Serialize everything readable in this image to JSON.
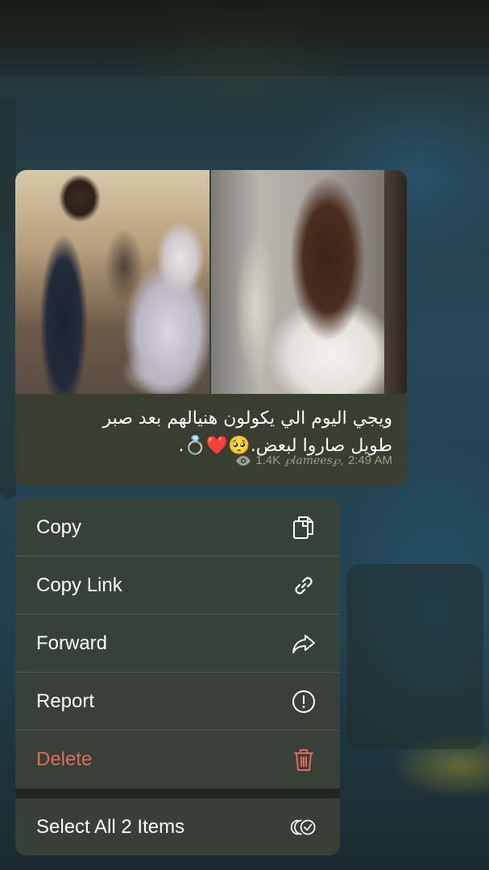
{
  "message": {
    "caption_line1": "ويجي اليوم الي يكولون هنيالهم بعد صبر",
    "caption_line2": "طويل صاروا لبعض.🥺❤️💍.",
    "views": "1.4K",
    "signature": "℘lamees℘,",
    "time": "2:49 AM"
  },
  "menu": {
    "items": [
      {
        "label": "Copy",
        "icon": "copy-icon"
      },
      {
        "label": "Copy Link",
        "icon": "link-icon"
      },
      {
        "label": "Forward",
        "icon": "forward-icon"
      },
      {
        "label": "Report",
        "icon": "report-icon"
      },
      {
        "label": "Delete",
        "icon": "trash-icon"
      },
      {
        "label": "Select All 2 Items",
        "icon": "select-all-icon"
      }
    ]
  },
  "colors": {
    "danger": "#e5685c",
    "menu_background": "#3a4237",
    "bubble_background": "#3a3e31"
  }
}
